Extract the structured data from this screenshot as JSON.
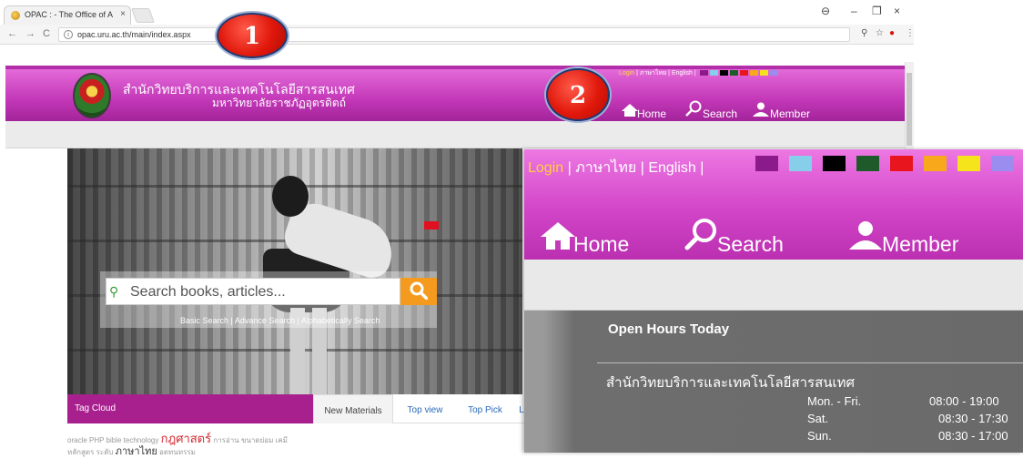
{
  "browser": {
    "tab_title": "OPAC : - The Office of A",
    "url": "opac.uru.ac.th/main/index.aspx"
  },
  "site": {
    "name_line1": "สำนักวิทยบริการและเทคโนโลยีสารสนเทศ",
    "name_line2": "มหาวิทยาลัยราชภัฏอุตรดิตถ์",
    "top_links": {
      "login": "Login",
      "thai": "ภาษาไทย",
      "english": "English",
      "separator": "|"
    },
    "color_swatches": [
      "#8b1a8b",
      "#87ceeb",
      "#000000",
      "#1f5a2a",
      "#e8141e",
      "#f7a81b",
      "#f5e31b",
      "#9b8cf0"
    ],
    "nav": {
      "home": "Home",
      "search": "Search",
      "member": "Member"
    }
  },
  "hero": {
    "search_placeholder": "Search books, articles...",
    "links": {
      "basic": "Basic Search",
      "advance": "Advance Search",
      "alpha": "Alphabetically Search",
      "separator": "|"
    }
  },
  "tag_cloud": {
    "title": "Tag Cloud",
    "line1": {
      "small1": "oracle PHP bible technology",
      "big": "กฎศาสตร์",
      "small2": "การอ่าน ขนาดย่อม เคมี"
    },
    "line2": {
      "small1": "หลักสูตร ระดับ",
      "mid": "ภาษาไทย",
      "small2": "อดทนทรรม"
    }
  },
  "content_tabs": {
    "new": "New Materials",
    "top_view": "Top view",
    "top_pick": "Top Pick",
    "more": "L"
  },
  "callouts": {
    "one": "1",
    "two": "2"
  },
  "hours": {
    "title": "Open Hours Today",
    "office": "สำนักวิทยบริการและเทคโนโลยีสารสนเทศ",
    "rows": [
      {
        "day": "Mon. - Fri.",
        "time": "08:00 - 19:00"
      },
      {
        "day": "Sat.",
        "time": "08:30 - 17:30"
      },
      {
        "day": "Sun.",
        "time": "08:30 - 17:00"
      }
    ]
  }
}
